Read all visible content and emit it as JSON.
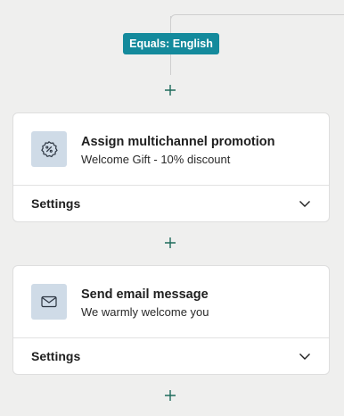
{
  "branch": {
    "condition_label": "Equals: English"
  },
  "steps": [
    {
      "icon": "percent-badge-icon",
      "title": "Assign multichannel promotion",
      "subtitle": "Welcome Gift - 10% discount",
      "settings_label": "Settings"
    },
    {
      "icon": "envelope-icon",
      "title": "Send email message",
      "subtitle": "We warmly welcome you",
      "settings_label": "Settings"
    }
  ],
  "colors": {
    "badge_background": "#148a9c",
    "icon_tile": "#cfdbe7",
    "add_icon": "#1f6b5c",
    "canvas": "#efefee"
  }
}
